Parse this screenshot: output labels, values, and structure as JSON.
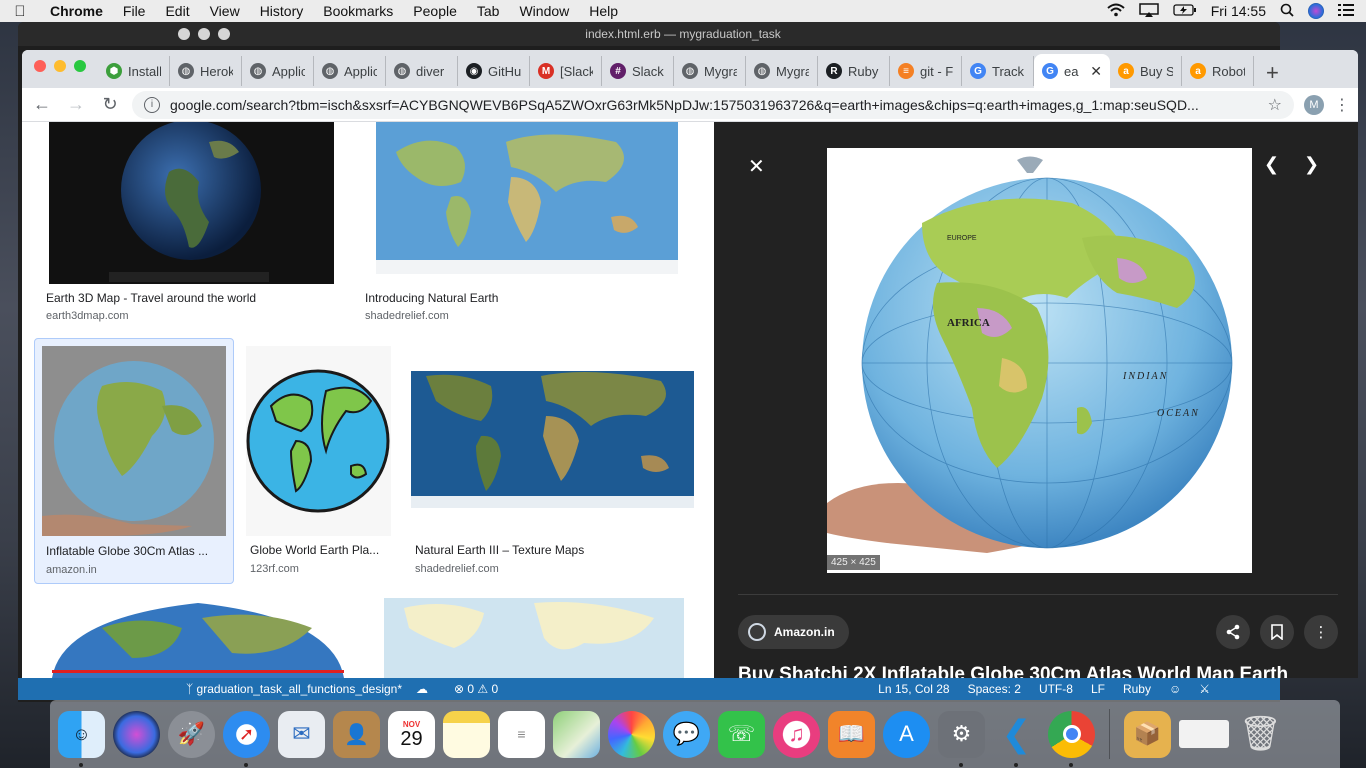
{
  "menubar": {
    "app": "Chrome",
    "items": [
      "File",
      "Edit",
      "View",
      "History",
      "Bookmarks",
      "People",
      "Tab",
      "Window",
      "Help"
    ],
    "clock": "Fri 14:55"
  },
  "vscode": {
    "window_title": "index.html.erb — mygraduation_task",
    "status": {
      "branch": "graduation_task_all_functions_design*",
      "problems": "⊗ 0 ⚠ 0",
      "cursor": "Ln 15, Col 28",
      "spaces": "Spaces: 2",
      "encoding": "UTF-8",
      "eol": "LF",
      "language": "Ruby"
    }
  },
  "tabs": [
    {
      "label": "Install",
      "icon": "hexagon-icon",
      "color": "#3c9f3c"
    },
    {
      "label": "Herok",
      "icon": "globe-icon",
      "color": "#5f6368"
    },
    {
      "label": "Applic",
      "icon": "globe-icon",
      "color": "#5f6368"
    },
    {
      "label": "Applic",
      "icon": "globe-icon",
      "color": "#5f6368"
    },
    {
      "label": "diver",
      "icon": "globe-icon",
      "color": "#5f6368"
    },
    {
      "label": "GitHu",
      "icon": "github-icon",
      "color": "#1b1f23"
    },
    {
      "label": "[Slack",
      "icon": "gmail-icon",
      "color": "#d93025"
    },
    {
      "label": "Slack",
      "icon": "slack-icon",
      "color": "#611f69"
    },
    {
      "label": "Mygra",
      "icon": "globe-icon",
      "color": "#5f6368"
    },
    {
      "label": "Mygra",
      "icon": "globe-icon",
      "color": "#5f6368"
    },
    {
      "label": "Ruby",
      "icon": "ruby-icon",
      "color": "#1b1f23"
    },
    {
      "label": "git - F",
      "icon": "stack-icon",
      "color": "#f48024"
    },
    {
      "label": "Track",
      "icon": "google-icon",
      "color": "#4285f4"
    },
    {
      "label": "ea",
      "icon": "google-icon",
      "color": "#4285f4",
      "active": true
    },
    {
      "label": "Buy S",
      "icon": "amazon-icon",
      "color": "#ff9900"
    },
    {
      "label": "Robot",
      "icon": "amazon-icon",
      "color": "#ff9900"
    }
  ],
  "omnibox": {
    "url": "google.com/search?tbm=isch&sxsrf=ACYBGNQWEVB6PSqA5ZWOxrG63rMk5NpDJw:1575031963726&q=earth+images&chips=q:earth+images,g_1:map:seuSQD..."
  },
  "profile_initial": "M",
  "results": [
    {
      "title": "Earth 3D Map - Travel around the world",
      "source": "earth3dmap.com"
    },
    {
      "title": "Introducing Natural Earth",
      "source": "shadedrelief.com"
    },
    {
      "title": "Inflatable Globe 30Cm Atlas ...",
      "source": "amazon.in",
      "selected": true
    },
    {
      "title": "Globe World Earth Pla...",
      "source": "123rf.com"
    },
    {
      "title": "Natural Earth III – Texture Maps",
      "source": "shadedrelief.com"
    }
  ],
  "viewer": {
    "dimensions": "425 × 425",
    "source": "Amazon.in",
    "title": "Buy Shatchi 2X Inflatable Globe 30Cm Atlas World Map Earth",
    "globe_labels": {
      "africa": "AFRICA",
      "indian": "INDIAN",
      "ocean": "OCEAN",
      "europe": "EUROPE"
    }
  },
  "dock": {
    "calendar_month": "NOV",
    "calendar_day": "29"
  },
  "colors": {
    "google_blue": "#1a73e8",
    "viewer_bg": "#222222",
    "vscode_status": "#1f6fb1"
  }
}
